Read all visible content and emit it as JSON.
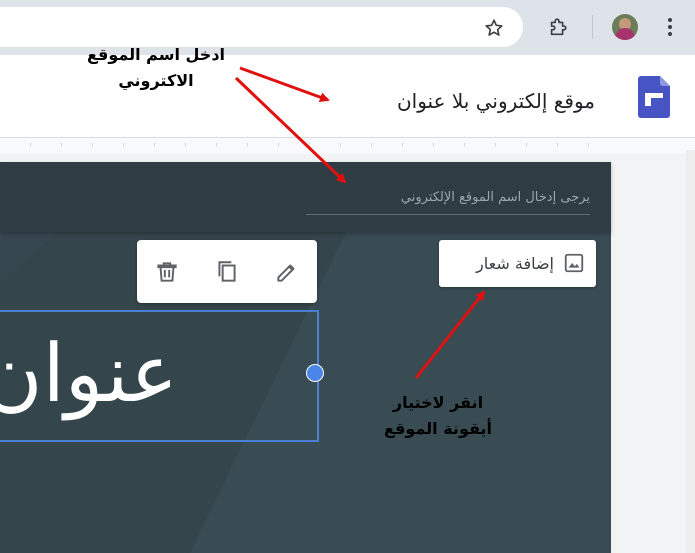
{
  "browser": {
    "bookmark_icon": "star-icon",
    "extensions_icon": "puzzle-icon",
    "menu_icon": "kebab-icon"
  },
  "sites": {
    "site_title": "موقع إلكتروني بلا عنوان",
    "site_name_placeholder": "يرجى إدخال اسم الموقع الإلكتروني",
    "add_logo_label": "إضافة شعار",
    "page_title_text": "عنوان"
  },
  "annotations": {
    "enter_site_name_line1": "ادخل اسم الموقع",
    "enter_site_name_line2": "الاكتروني",
    "choose_icon_line1": "انقر لاختيار",
    "choose_icon_line2": "أيقونة الموقع"
  },
  "colors": {
    "canvas": "#37474f",
    "accent": "#4a86e8",
    "arrow": "#e0100f"
  }
}
